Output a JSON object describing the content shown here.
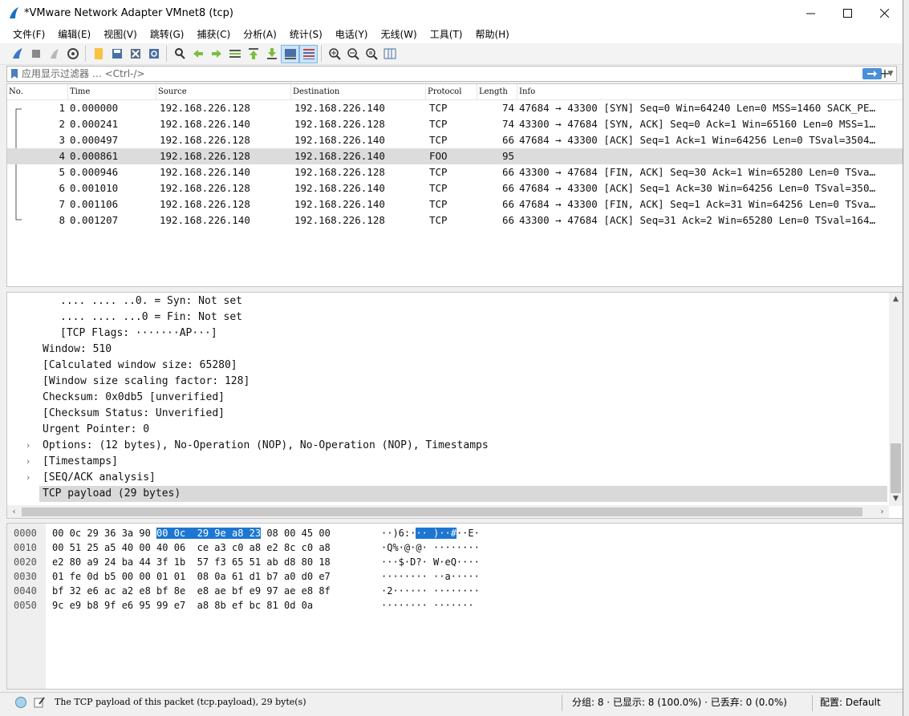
{
  "window": {
    "title": "*VMware Network Adapter VMnet8 (tcp)",
    "controls": [
      "minimize-icon",
      "maximize-icon",
      "close-icon"
    ]
  },
  "menu": [
    "文件(F)",
    "编辑(E)",
    "视图(V)",
    "跳转(G)",
    "捕获(C)",
    "分析(A)",
    "统计(S)",
    "电话(Y)",
    "无线(W)",
    "工具(T)",
    "帮助(H)"
  ],
  "filter": {
    "placeholder": "应用显示过滤器 … <Ctrl-/>",
    "add": "+"
  },
  "packet_list": {
    "columns": [
      "No.",
      "Time",
      "Source",
      "Destination",
      "Protocol",
      "Length",
      "Info"
    ],
    "selected_index": 3,
    "rows": [
      {
        "no": "1",
        "time": "0.000000",
        "src": "192.168.226.128",
        "dst": "192.168.226.140",
        "proto": "TCP",
        "len": "74",
        "info": "47684 → 43300 [SYN] Seq=0 Win=64240 Len=0 MSS=1460 SACK_PE…"
      },
      {
        "no": "2",
        "time": "0.000241",
        "src": "192.168.226.140",
        "dst": "192.168.226.128",
        "proto": "TCP",
        "len": "74",
        "info": "43300 → 47684 [SYN, ACK] Seq=0 Ack=1 Win=65160 Len=0 MSS=1…"
      },
      {
        "no": "3",
        "time": "0.000497",
        "src": "192.168.226.128",
        "dst": "192.168.226.140",
        "proto": "TCP",
        "len": "66",
        "info": "47684 → 43300 [ACK] Seq=1 Ack=1 Win=64256 Len=0 TSval=3504…"
      },
      {
        "no": "4",
        "time": "0.000861",
        "src": "192.168.226.128",
        "dst": "192.168.226.140",
        "proto": "FOO",
        "len": "95",
        "info": ""
      },
      {
        "no": "5",
        "time": "0.000946",
        "src": "192.168.226.140",
        "dst": "192.168.226.128",
        "proto": "TCP",
        "len": "66",
        "info": "43300 → 47684 [FIN, ACK] Seq=30 Ack=1 Win=65280 Len=0 TSva…"
      },
      {
        "no": "6",
        "time": "0.001010",
        "src": "192.168.226.128",
        "dst": "192.168.226.140",
        "proto": "TCP",
        "len": "66",
        "info": "47684 → 43300 [ACK] Seq=1 Ack=30 Win=64256 Len=0 TSval=350…"
      },
      {
        "no": "7",
        "time": "0.001106",
        "src": "192.168.226.128",
        "dst": "192.168.226.140",
        "proto": "TCP",
        "len": "66",
        "info": "47684 → 43300 [FIN, ACK] Seq=1 Ack=31 Win=64256 Len=0 TSva…"
      },
      {
        "no": "8",
        "time": "0.001207",
        "src": "192.168.226.140",
        "dst": "192.168.226.128",
        "proto": "TCP",
        "len": "66",
        "info": "43300 → 47684 [ACK] Seq=31 Ack=2 Win=65280 Len=0 TSval=164…"
      }
    ]
  },
  "details": {
    "lines": [
      {
        "indent": 2,
        "text": ".... .... ..0. = Syn: Not set",
        "expander": false
      },
      {
        "indent": 2,
        "text": ".... .... ...0 = Fin: Not set",
        "expander": false
      },
      {
        "indent": 2,
        "text": "[TCP Flags: ·······AP···]",
        "expander": false
      },
      {
        "indent": 1,
        "text": "Window: 510",
        "expander": false
      },
      {
        "indent": 1,
        "text": "[Calculated window size: 65280]",
        "expander": false
      },
      {
        "indent": 1,
        "text": "[Window size scaling factor: 128]",
        "expander": false
      },
      {
        "indent": 1,
        "text": "Checksum: 0x0db5 [unverified]",
        "expander": false
      },
      {
        "indent": 1,
        "text": "[Checksum Status: Unverified]",
        "expander": false
      },
      {
        "indent": 1,
        "text": "Urgent Pointer: 0",
        "expander": false
      },
      {
        "indent": 1,
        "text": "Options: (12 bytes), No-Operation (NOP), No-Operation (NOP), Timestamps",
        "expander": true
      },
      {
        "indent": 1,
        "text": "[Timestamps]",
        "expander": true
      },
      {
        "indent": 1,
        "text": "[SEQ/ACK analysis]",
        "expander": true
      },
      {
        "indent": 1,
        "text": "TCP payload (29 bytes)",
        "expander": false,
        "selected": true
      }
    ]
  },
  "bytes": {
    "rows": [
      {
        "offset": "0000",
        "hex_pre": "00 0c 29 36 3a 90 ",
        "hex_hl": "00 0c  29 9e a8 23",
        "hex_post": " 08 00 45 00",
        "ascii_pre": "··)6:·",
        "ascii_hl": "·· )··#",
        "ascii_post": "··E·"
      },
      {
        "offset": "0010",
        "hex_pre": "00 51 25 a5 40 00 40 06  ce a3 c0 a8 e2 8c c0 a8",
        "hex_hl": "",
        "hex_post": "",
        "ascii_pre": "·Q%·@·@· ········",
        "ascii_hl": "",
        "ascii_post": ""
      },
      {
        "offset": "0020",
        "hex_pre": "e2 80 a9 24 ba 44 3f 1b  57 f3 65 51 ab d8 80 18",
        "hex_hl": "",
        "hex_post": "",
        "ascii_pre": "···$·D?· W·eQ····",
        "ascii_hl": "",
        "ascii_post": ""
      },
      {
        "offset": "0030",
        "hex_pre": "01 fe 0d b5 00 00 01 01  08 0a 61 d1 b7 a0 d0 e7",
        "hex_hl": "",
        "hex_post": "",
        "ascii_pre": "········ ··a·····",
        "ascii_hl": "",
        "ascii_post": ""
      },
      {
        "offset": "0040",
        "hex_pre": "bf 32 e6 ac a2 e8 bf 8e  e8 ae bf e9 97 ae e8 8f",
        "hex_hl": "",
        "hex_post": "",
        "ascii_pre": "·2······ ········",
        "ascii_hl": "",
        "ascii_post": ""
      },
      {
        "offset": "0050",
        "hex_pre": "9c e9 b8 9f e6 95 99 e7  a8 8b ef bc 81 0d 0a",
        "hex_hl": "",
        "hex_post": "",
        "ascii_pre": "········ ·······",
        "ascii_hl": "",
        "ascii_post": ""
      }
    ]
  },
  "status": {
    "field_info": "The TCP payload of this packet (tcp.payload), 29 byte(s)",
    "packets": "分组: 8 · 已显示: 8 (100.0%) · 已丢弃: 0 (0.0%)",
    "profile": "配置: Default"
  },
  "colors": {
    "selection": "#1c76d2",
    "row_selected": "#dcdcdc"
  }
}
